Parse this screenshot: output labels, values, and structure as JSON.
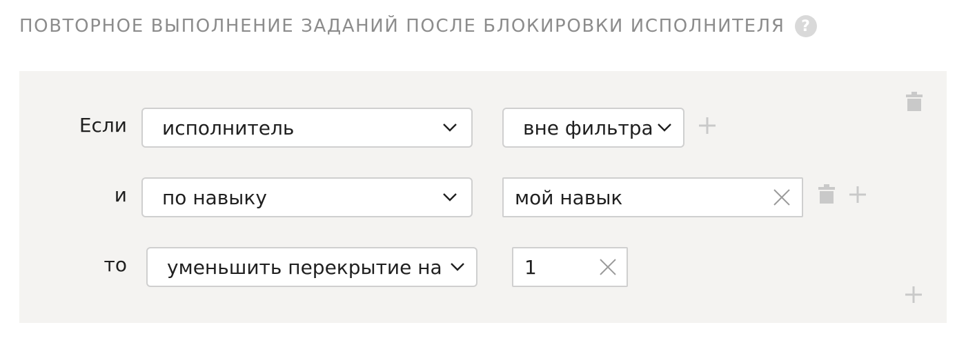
{
  "section": {
    "title": "Повторное выполнение заданий после блокировки исполнителя",
    "help_icon": "question-mark-icon",
    "help_glyph": "?"
  },
  "rule": {
    "conditions": [
      {
        "connector": "Если",
        "field": "исполнитель",
        "operator": "вне фильтра"
      },
      {
        "connector": "и",
        "field": "по навыку",
        "value": "мой навык"
      }
    ],
    "action": {
      "connector": "то",
      "type": "уменьшить перекрытие на",
      "value": "1"
    }
  },
  "colors": {
    "panel_bg": "#f4f3f1",
    "muted_text": "#8c8c8c",
    "icon_gray": "#c9c9c9",
    "border": "#cfcfcf"
  }
}
